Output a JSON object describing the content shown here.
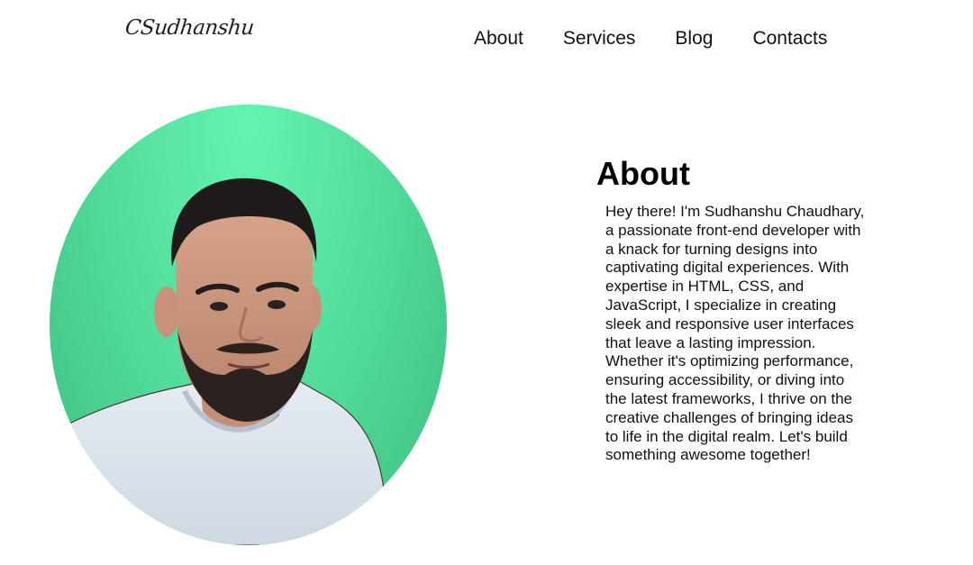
{
  "header": {
    "logo": "CSudhanshu",
    "nav": [
      {
        "label": "About"
      },
      {
        "label": "Services"
      },
      {
        "label": "Blog"
      },
      {
        "label": "Contacts"
      }
    ]
  },
  "hero": {
    "photo_icon": "profile-photo",
    "bg_color": "#5ce6a3"
  },
  "about": {
    "title": "About",
    "text": "Hey there! I'm Sudhanshu Chaudhary, a passionate front-end developer with a knack for turning designs into captivating digital experiences. With expertise in HTML, CSS, and JavaScript, I specialize in creating sleek and responsive user interfaces that leave a lasting impression. Whether it's optimizing performance, ensuring accessibility, or diving into the latest frameworks, I thrive on the creative challenges of bringing ideas to life in the digital realm. Let's build something awesome together!"
  }
}
